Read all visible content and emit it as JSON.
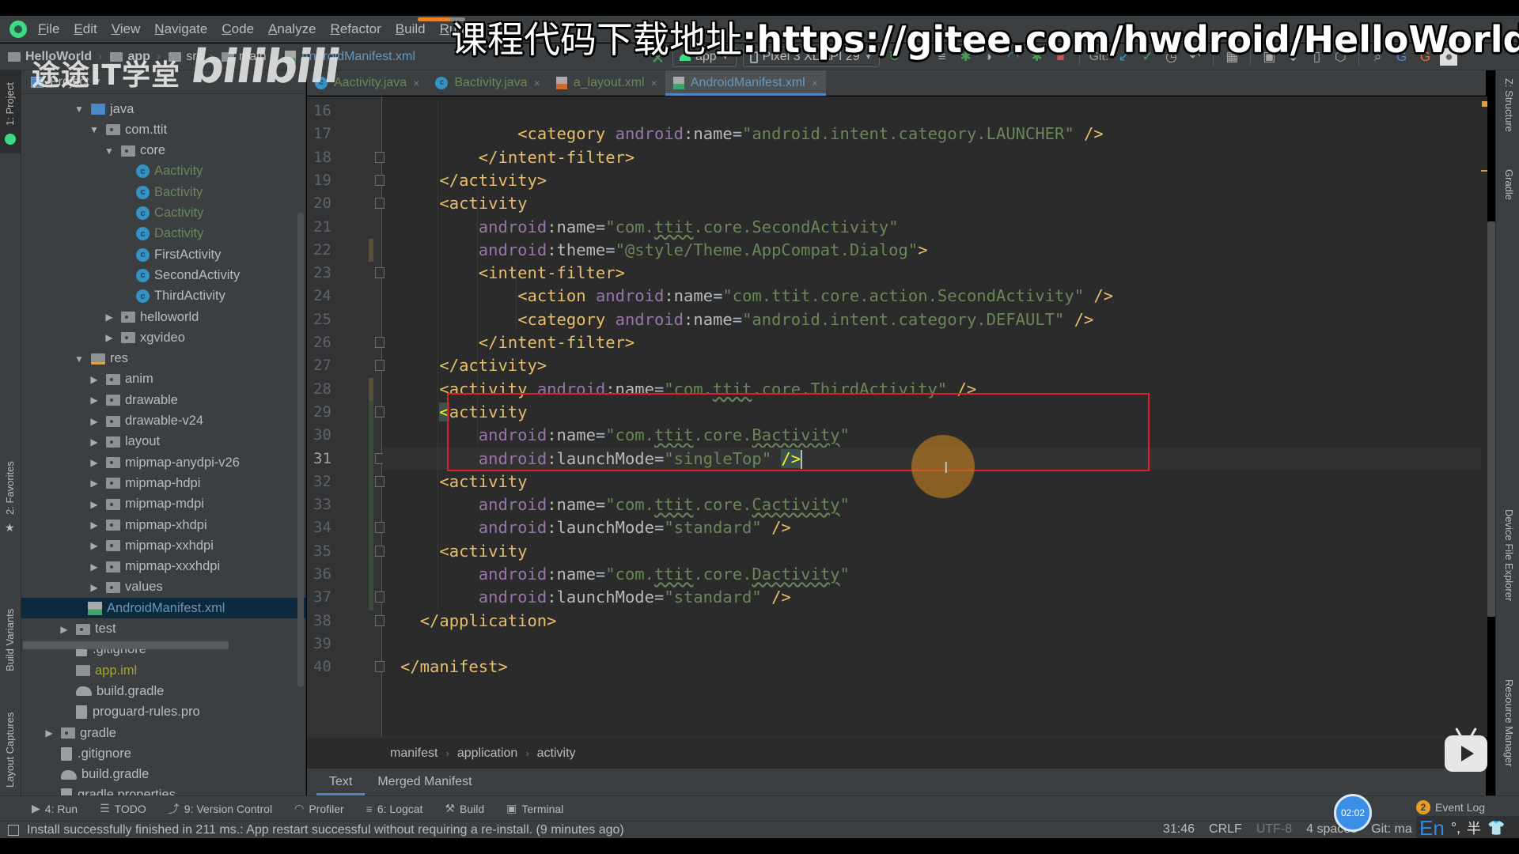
{
  "overlay": {
    "title_cn": "课程代码下载地址",
    "title_url": ":https://gitee.com/hwdroid/HelloWorld",
    "school_watermark": "途途IT学堂",
    "bili_watermark": "bilibili"
  },
  "menu": {
    "items": [
      "File",
      "Edit",
      "View",
      "Navigate",
      "Code",
      "Analyze",
      "Refactor",
      "Build",
      "Run"
    ]
  },
  "nav_breadcrumb": {
    "items": [
      {
        "label": "HelloWorld"
      },
      {
        "label": "app"
      },
      {
        "label": "src"
      },
      {
        "label": "main"
      },
      {
        "label": "AndroidManifest.xml"
      }
    ]
  },
  "toolbar": {
    "run_config": "app",
    "device": "Pixel 3 XL API 29",
    "git_label": "Git:"
  },
  "left_strip": {
    "project_tab": "1: Project",
    "favorites_tab": "2: Favorites",
    "build_variants_tab": "Build Variants",
    "layout_captures_tab": "Layout Captures"
  },
  "right_strip": {
    "structure_tab": "Z: Structure",
    "gradle_tab": "Gradle",
    "device_file_explorer_tab": "Device File Explorer",
    "resource_manager_tab": "Resource Manager"
  },
  "project_panel": {
    "header": "Project",
    "tree": [
      {
        "label": "java",
        "icon": "source-folder-icon",
        "expanded": true
      },
      {
        "label": "com.ttit",
        "icon": "package-icon",
        "expanded": true
      },
      {
        "label": "core",
        "icon": "package-icon",
        "expanded": true
      },
      {
        "label": "Aactivity",
        "icon": "class-icon",
        "status": "added"
      },
      {
        "label": "Bactivity",
        "icon": "class-icon",
        "status": "added"
      },
      {
        "label": "Cactivity",
        "icon": "class-icon",
        "status": "added"
      },
      {
        "label": "Dactivity",
        "icon": "class-icon",
        "status": "added"
      },
      {
        "label": "FirstActivity",
        "icon": "class-icon"
      },
      {
        "label": "SecondActivity",
        "icon": "class-icon"
      },
      {
        "label": "ThirdActivity",
        "icon": "class-icon"
      },
      {
        "label": "helloworld",
        "icon": "package-icon",
        "expanded": false
      },
      {
        "label": "xgvideo",
        "icon": "package-icon",
        "expanded": false
      },
      {
        "label": "res",
        "icon": "resource-folder-icon",
        "expanded": true
      },
      {
        "label": "anim",
        "icon": "folder-icon",
        "expanded": false
      },
      {
        "label": "drawable",
        "icon": "folder-icon",
        "expanded": false
      },
      {
        "label": "drawable-v24",
        "icon": "folder-icon",
        "expanded": false
      },
      {
        "label": "layout",
        "icon": "folder-icon",
        "expanded": false
      },
      {
        "label": "mipmap-anydpi-v26",
        "icon": "folder-icon",
        "expanded": false
      },
      {
        "label": "mipmap-hdpi",
        "icon": "folder-icon",
        "expanded": false
      },
      {
        "label": "mipmap-mdpi",
        "icon": "folder-icon",
        "expanded": false
      },
      {
        "label": "mipmap-xhdpi",
        "icon": "folder-icon",
        "expanded": false
      },
      {
        "label": "mipmap-xxhdpi",
        "icon": "folder-icon",
        "expanded": false
      },
      {
        "label": "mipmap-xxxhdpi",
        "icon": "folder-icon",
        "expanded": false
      },
      {
        "label": "values",
        "icon": "folder-icon",
        "expanded": false
      },
      {
        "label": "AndroidManifest.xml",
        "icon": "manifest-icon",
        "selected": true
      },
      {
        "label": "test",
        "icon": "folder-icon",
        "expanded": false
      },
      {
        "label": ".gitignore",
        "icon": "ignore-file-icon"
      },
      {
        "label": "app.iml",
        "icon": "module-file-icon",
        "status": "untracked"
      },
      {
        "label": "build.gradle",
        "icon": "gradle-icon"
      },
      {
        "label": "proguard-rules.pro",
        "icon": "text-file-icon"
      },
      {
        "label": "gradle",
        "icon": "folder-icon",
        "expanded": false
      },
      {
        "label": ".gitignore",
        "icon": "ignore-file-icon"
      },
      {
        "label": "build.gradle",
        "icon": "gradle-icon"
      },
      {
        "label": "gradle.properties",
        "icon": "properties-file-icon"
      }
    ]
  },
  "editor_tabs": [
    {
      "label": "Aactivity.java",
      "type": "class"
    },
    {
      "label": "Bactivity.java",
      "type": "class"
    },
    {
      "label": "a_layout.xml",
      "type": "layout"
    },
    {
      "label": "AndroidManifest.xml",
      "type": "manifest",
      "active": true
    }
  ],
  "editor": {
    "current_line": 31,
    "lines": [
      {
        "n": 16,
        "indent": 0,
        "tokens": []
      },
      {
        "n": 17,
        "indent": 12,
        "tokens": [
          [
            "tag",
            "<category "
          ],
          [
            "ns",
            "android"
          ],
          [
            "attr",
            ":name"
          ],
          [
            "punc",
            "="
          ],
          [
            "str",
            "\"android.intent.category.LAUNCHER\""
          ],
          [
            "tag",
            " />"
          ]
        ]
      },
      {
        "n": 18,
        "indent": 8,
        "tokens": [
          [
            "tag",
            "</intent-filter>"
          ]
        ]
      },
      {
        "n": 19,
        "indent": 4,
        "tokens": [
          [
            "tag",
            "</activity>"
          ]
        ]
      },
      {
        "n": 20,
        "indent": 4,
        "tokens": [
          [
            "tag",
            "<activity"
          ]
        ]
      },
      {
        "n": 21,
        "indent": 8,
        "tokens": [
          [
            "ns",
            "android"
          ],
          [
            "attr",
            ":name"
          ],
          [
            "punc",
            "="
          ],
          [
            "str",
            "\"com."
          ],
          [
            "sq",
            "ttit"
          ],
          [
            "str",
            ".core.SecondActivity\""
          ]
        ]
      },
      {
        "n": 22,
        "indent": 8,
        "tokens": [
          [
            "ns",
            "android"
          ],
          [
            "attr",
            ":theme"
          ],
          [
            "punc",
            "="
          ],
          [
            "str",
            "\"@style/Theme.AppCompat.Dialog\""
          ],
          [
            "tag",
            ">"
          ]
        ]
      },
      {
        "n": 23,
        "indent": 8,
        "tokens": [
          [
            "tag",
            "<intent-filter>"
          ]
        ]
      },
      {
        "n": 24,
        "indent": 12,
        "tokens": [
          [
            "tag",
            "<action "
          ],
          [
            "ns",
            "android"
          ],
          [
            "attr",
            ":name"
          ],
          [
            "punc",
            "="
          ],
          [
            "str",
            "\"com.ttit.core.action.SecondActivity\""
          ],
          [
            "tag",
            " />"
          ]
        ]
      },
      {
        "n": 25,
        "indent": 12,
        "tokens": [
          [
            "tag",
            "<category "
          ],
          [
            "ns",
            "android"
          ],
          [
            "attr",
            ":name"
          ],
          [
            "punc",
            "="
          ],
          [
            "str",
            "\"android.intent.category.DEFAULT\""
          ],
          [
            "tag",
            " />"
          ]
        ]
      },
      {
        "n": 26,
        "indent": 8,
        "tokens": [
          [
            "tag",
            "</intent-filter>"
          ]
        ]
      },
      {
        "n": 27,
        "indent": 4,
        "tokens": [
          [
            "tag",
            "</activity>"
          ]
        ]
      },
      {
        "n": 28,
        "indent": 4,
        "tokens": [
          [
            "tag",
            "<activity "
          ],
          [
            "ns",
            "android"
          ],
          [
            "attr",
            ":name"
          ],
          [
            "punc",
            "="
          ],
          [
            "str",
            "\"com."
          ],
          [
            "sq",
            "ttit"
          ],
          [
            "str",
            ".core.ThirdActivity\""
          ],
          [
            "tag",
            " />"
          ]
        ]
      },
      {
        "n": 29,
        "indent": 4,
        "tokens": [
          [
            "caretb",
            "<"
          ],
          [
            "tag",
            "activity"
          ]
        ]
      },
      {
        "n": 30,
        "indent": 8,
        "tokens": [
          [
            "ns",
            "android"
          ],
          [
            "attr",
            ":name"
          ],
          [
            "punc",
            "="
          ],
          [
            "str",
            "\"com."
          ],
          [
            "sq",
            "ttit"
          ],
          [
            "str",
            ".core."
          ],
          [
            "sq",
            "Bactivity"
          ],
          [
            "str",
            "\""
          ]
        ]
      },
      {
        "n": 31,
        "indent": 8,
        "tokens": [
          [
            "ns",
            "android"
          ],
          [
            "attr",
            ":launchMode"
          ],
          [
            "punc",
            "="
          ],
          [
            "str",
            "\"singleTop\""
          ],
          [
            "punc",
            " "
          ],
          [
            "caretb",
            "/>"
          ],
          [
            "cursor",
            ""
          ]
        ]
      },
      {
        "n": 32,
        "indent": 4,
        "tokens": [
          [
            "tag",
            "<activity"
          ]
        ]
      },
      {
        "n": 33,
        "indent": 8,
        "tokens": [
          [
            "ns",
            "android"
          ],
          [
            "attr",
            ":name"
          ],
          [
            "punc",
            "="
          ],
          [
            "str",
            "\"com."
          ],
          [
            "sq",
            "ttit"
          ],
          [
            "str",
            ".core."
          ],
          [
            "sq",
            "Cactivity"
          ],
          [
            "str",
            "\""
          ]
        ]
      },
      {
        "n": 34,
        "indent": 8,
        "tokens": [
          [
            "ns",
            "android"
          ],
          [
            "attr",
            ":launchMode"
          ],
          [
            "punc",
            "="
          ],
          [
            "str",
            "\"standard\""
          ],
          [
            "tag",
            " />"
          ]
        ]
      },
      {
        "n": 35,
        "indent": 4,
        "tokens": [
          [
            "tag",
            "<activity"
          ]
        ]
      },
      {
        "n": 36,
        "indent": 8,
        "tokens": [
          [
            "ns",
            "android"
          ],
          [
            "attr",
            ":name"
          ],
          [
            "punc",
            "="
          ],
          [
            "str",
            "\"com."
          ],
          [
            "sq",
            "ttit"
          ],
          [
            "str",
            ".core."
          ],
          [
            "sq",
            "Dactivity"
          ],
          [
            "str",
            "\""
          ]
        ]
      },
      {
        "n": 37,
        "indent": 8,
        "tokens": [
          [
            "ns",
            "android"
          ],
          [
            "attr",
            ":launchMode"
          ],
          [
            "punc",
            "="
          ],
          [
            "str",
            "\"standard\""
          ],
          [
            "tag",
            " />"
          ]
        ]
      },
      {
        "n": 38,
        "indent": 2,
        "tokens": [
          [
            "tag",
            "</application>"
          ]
        ]
      },
      {
        "n": 39,
        "indent": 0,
        "tokens": []
      },
      {
        "n": 40,
        "indent": 0,
        "tokens": [
          [
            "tag",
            "</manifest>"
          ]
        ]
      }
    ]
  },
  "xml_breadcrumb": [
    "manifest",
    "application",
    "activity"
  ],
  "editor_bottom_tabs": [
    {
      "label": "Text",
      "active": true
    },
    {
      "label": "Merged Manifest"
    }
  ],
  "tool_windows": [
    {
      "label": "4: Run",
      "icon": "run-icon"
    },
    {
      "label": "TODO",
      "icon": "todo-icon"
    },
    {
      "label": "9: Version Control",
      "icon": "vcs-icon"
    },
    {
      "label": "Profiler",
      "icon": "profiler-icon"
    },
    {
      "label": "6: Logcat",
      "icon": "logcat-icon"
    },
    {
      "label": "Build",
      "icon": "build-icon"
    },
    {
      "label": "Terminal",
      "icon": "terminal-icon"
    }
  ],
  "event_log": {
    "label": "Event Log",
    "count": "2"
  },
  "status": {
    "message": "Install successfully finished in 211 ms.: App restart successful without requiring a re-install. (9 minutes ago)",
    "position": "31:46",
    "line_separator": "CRLF",
    "encoding": "UTF-8",
    "indent": "4 spaces",
    "git_branch": "Git: ma"
  },
  "video_timer": "02:02",
  "ime": {
    "lang": "En",
    "punct": "°,",
    "width": "半"
  }
}
